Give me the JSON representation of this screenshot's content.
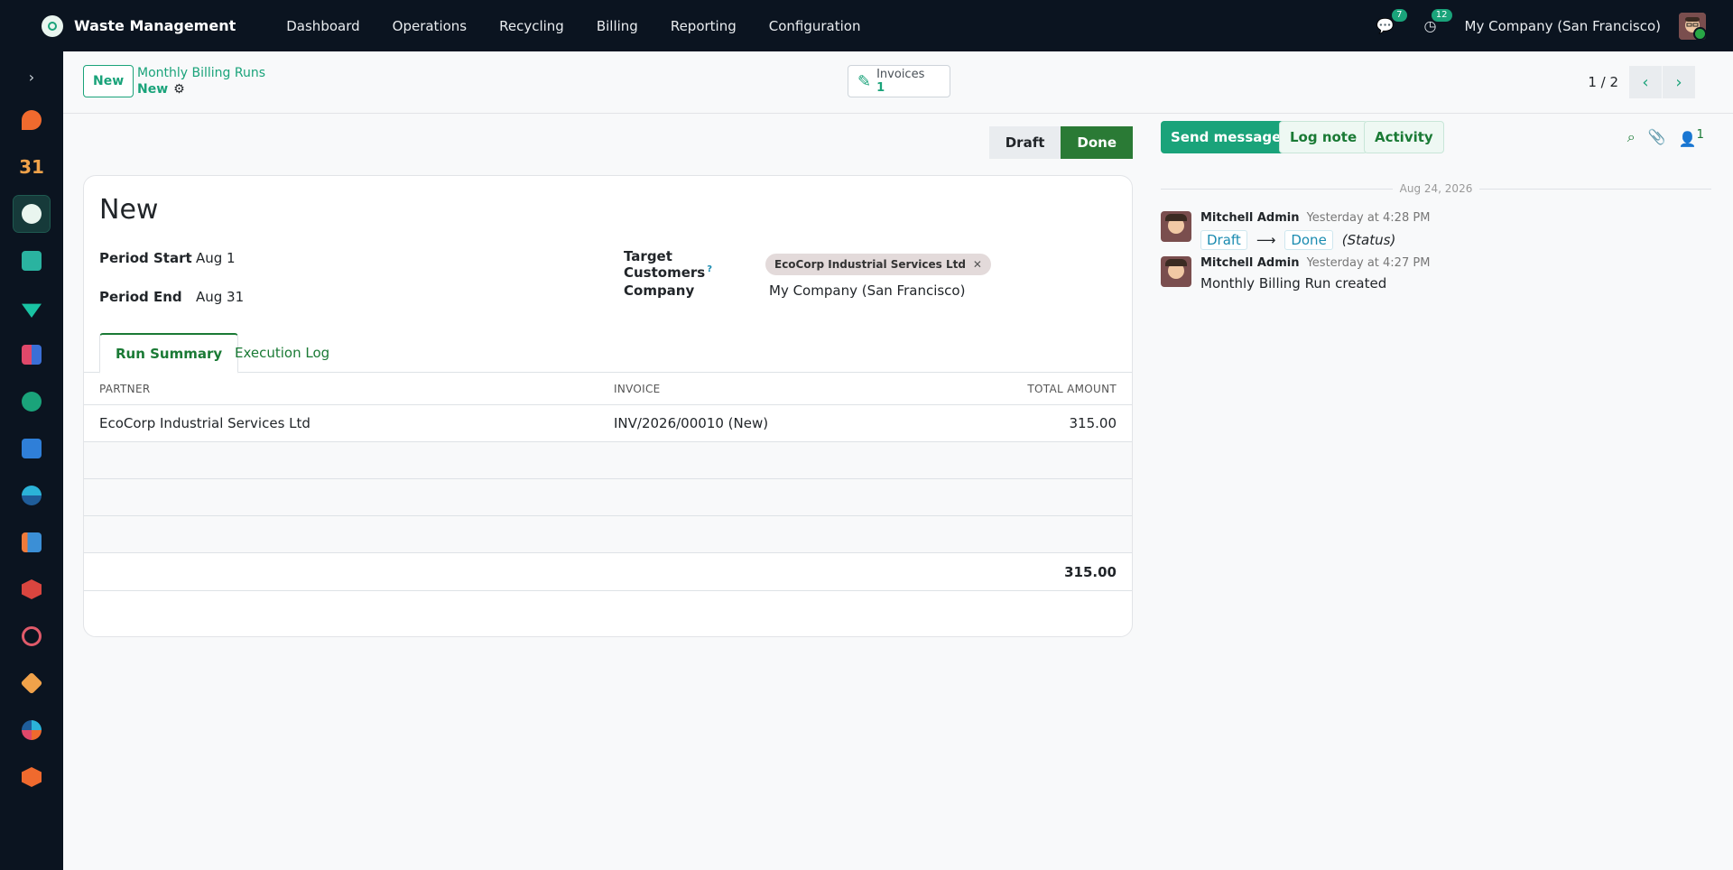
{
  "navbar": {
    "app_name": "Waste Management",
    "menu": [
      "Dashboard",
      "Operations",
      "Recycling",
      "Billing",
      "Reporting",
      "Configuration"
    ],
    "messages_count": "7",
    "activities_count": "12",
    "company": "My Company (San Francisco)"
  },
  "control": {
    "new_label": "New",
    "breadcrumb_parent": "Monthly Billing Runs",
    "breadcrumb_current": "New",
    "smart_button": {
      "label": "Invoices",
      "value": "1"
    },
    "pager": "1 / 2"
  },
  "statusbar": {
    "stages": [
      "Draft",
      "Done"
    ],
    "current": "Done"
  },
  "form": {
    "title": "New",
    "period_start_label": "Period Start",
    "period_start": "Aug 1",
    "period_end_label": "Period End",
    "period_end": "Aug 31",
    "target_customers_label": "Target Customers",
    "help_mark": "?",
    "target_customers_tag": "EcoCorp Industrial Services Ltd",
    "company_label": "Company",
    "company": "My Company (San Francisco)"
  },
  "tabs": [
    "Run Summary",
    "Execution Log"
  ],
  "table": {
    "columns": [
      "PARTNER",
      "INVOICE",
      "TOTAL AMOUNT"
    ],
    "rows": [
      {
        "partner": "EcoCorp Industrial Services Ltd",
        "invoice": "INV/2026/00010 (New)",
        "amount": "315.00"
      }
    ],
    "total": "315.00"
  },
  "chatter": {
    "send_message": "Send message",
    "log_note": "Log note",
    "activity": "Activity",
    "followers_count": "1",
    "date_separator": "Aug 24, 2026",
    "messages": [
      {
        "author": "Mitchell Admin",
        "time": "Yesterday at 4:28 PM",
        "from": "Draft",
        "to": "Done",
        "field": "(Status)"
      },
      {
        "author": "Mitchell Admin",
        "time": "Yesterday at 4:27 PM",
        "body": "Monthly Billing Run created"
      }
    ]
  },
  "colors": {
    "brand": "#1aa37a",
    "navbar": "#0b1420",
    "done_stage": "#2a7a35"
  }
}
